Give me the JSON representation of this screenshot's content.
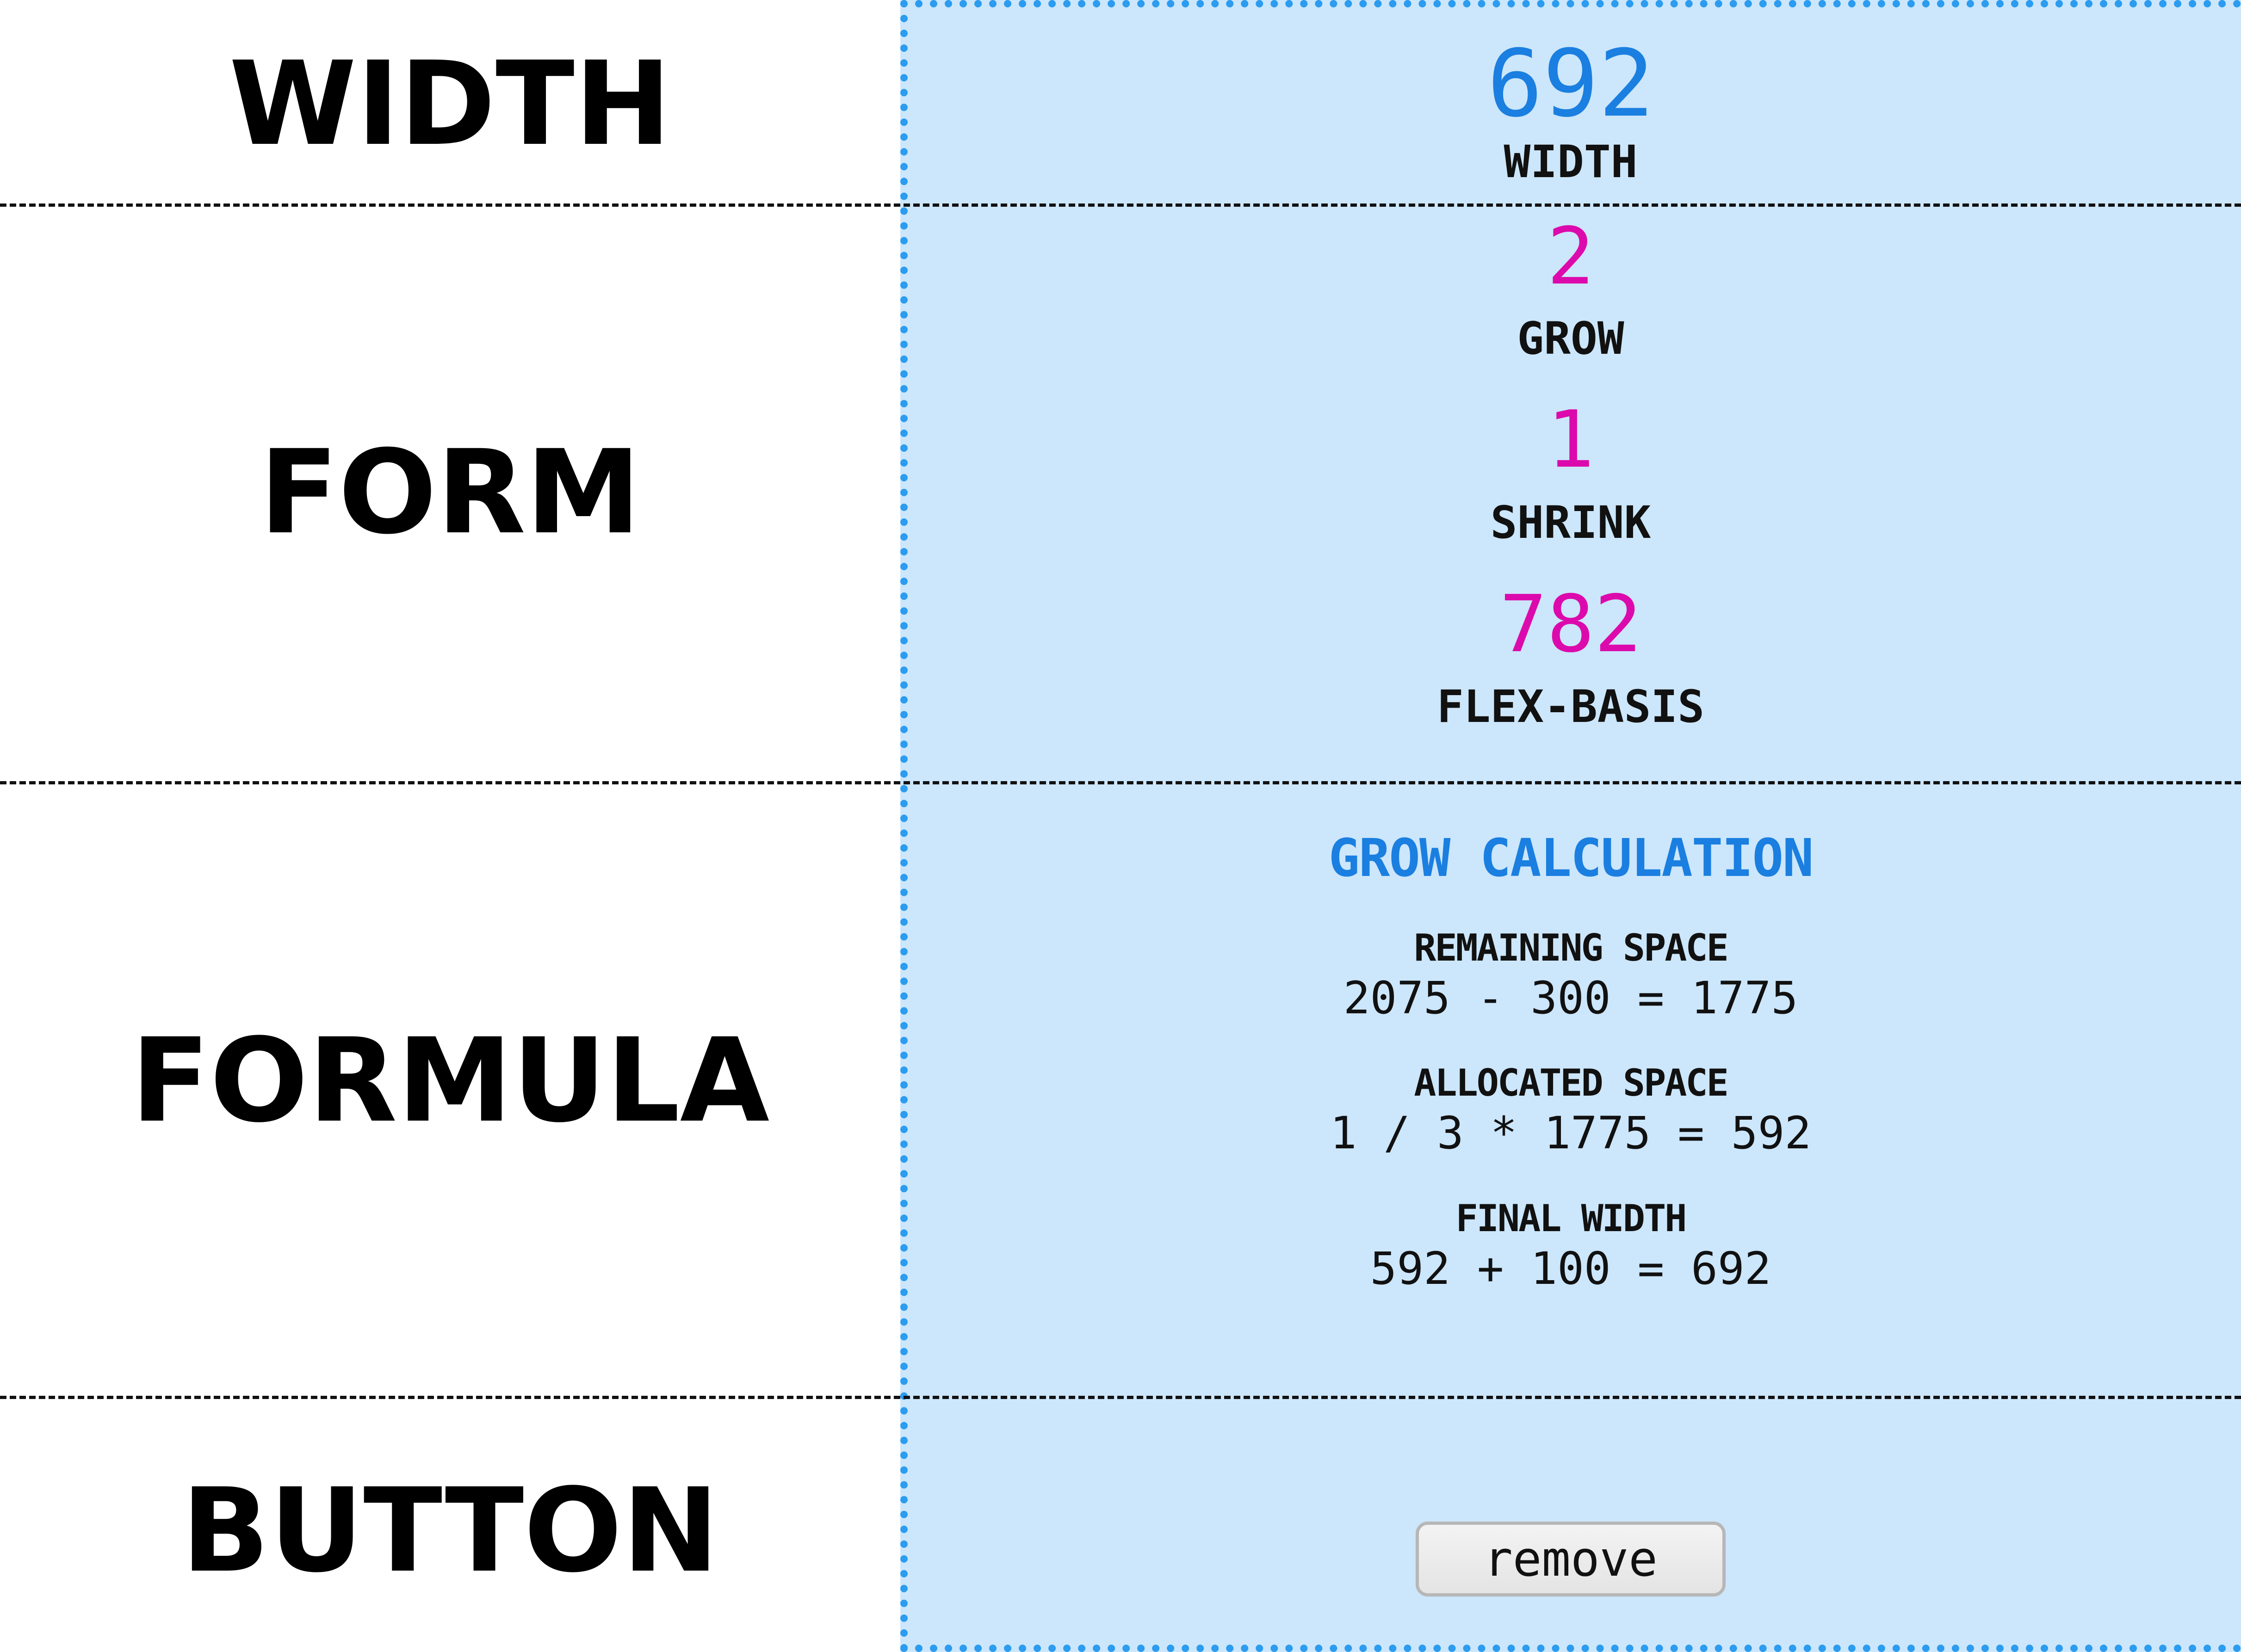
{
  "rows": {
    "width_title": "WIDTH",
    "form_title": "FORM",
    "formula_title": "FORMULA",
    "button_title": "BUTTON"
  },
  "width_section": {
    "value": "692",
    "label": "WIDTH"
  },
  "form_section": {
    "grow_value": "2",
    "grow_label": "GROW",
    "shrink_value": "1",
    "shrink_label": "SHRINK",
    "basis_value": "782",
    "basis_label": "FLEX-BASIS"
  },
  "formula_section": {
    "title": "GROW CALCULATION",
    "remaining_label": "REMAINING SPACE",
    "remaining_eq": "2075 - 300 = 1775",
    "allocated_label": "ALLOCATED SPACE",
    "allocated_eq": "1 / 3 * 1775 = 592",
    "final_label": "FINAL WIDTH",
    "final_eq": "592 + 100 = 692"
  },
  "button_section": {
    "remove_label": "remove"
  },
  "colors": {
    "panel_bg": "#cce6fb",
    "panel_border": "#2b9cf0",
    "accent_blue": "#1a7fe0",
    "accent_magenta": "#dc0aad"
  }
}
